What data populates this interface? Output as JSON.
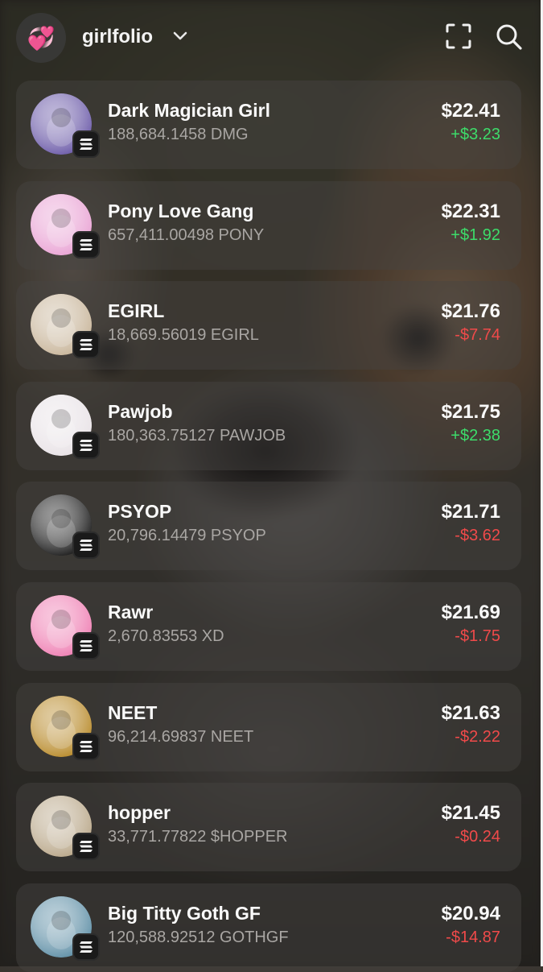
{
  "header": {
    "wallet_emoji": "💞",
    "wallet_name": "girlfolio",
    "icons": [
      "chevron-down-icon",
      "scan-icon",
      "search-icon"
    ]
  },
  "colors": {
    "positive": "#3ddc6a",
    "negative": "#f04a4a"
  },
  "tokens": [
    {
      "name": "Dark Magician Girl",
      "balance": "188,684.1458 DMG",
      "value": "$22.41",
      "change": "+$3.23",
      "trend": "up",
      "icon_color": "#6b5aa8"
    },
    {
      "name": "Pony Love Gang",
      "balance": "657,411.00498 PONY",
      "value": "$22.31",
      "change": "+$1.92",
      "trend": "up",
      "icon_color": "#e9a3d4"
    },
    {
      "name": "EGIRL",
      "balance": "18,669.56019 EGIRL",
      "value": "$21.76",
      "change": "-$7.74",
      "trend": "down",
      "icon_color": "#c8b59a"
    },
    {
      "name": "Pawjob",
      "balance": "180,363.75127 PAWJOB",
      "value": "$21.75",
      "change": "+$2.38",
      "trend": "up",
      "icon_color": "#e8e2e6"
    },
    {
      "name": "PSYOP",
      "balance": "20,796.14479 PSYOP",
      "value": "$21.71",
      "change": "-$3.62",
      "trend": "down",
      "icon_color": "#1b1b1b"
    },
    {
      "name": "Rawr",
      "balance": "2,670.83553 XD",
      "value": "$21.69",
      "change": "-$1.75",
      "trend": "down",
      "icon_color": "#ef7fb3"
    },
    {
      "name": "NEET",
      "balance": "96,214.69837 NEET",
      "value": "$21.63",
      "change": "-$2.22",
      "trend": "down",
      "icon_color": "#b88a2a"
    },
    {
      "name": "hopper",
      "balance": "33,771.77822 $HOPPER",
      "value": "$21.45",
      "change": "-$0.24",
      "trend": "down",
      "icon_color": "#b9a789"
    },
    {
      "name": "Big Titty Goth GF",
      "balance": "120,588.92512 GOTHGF",
      "value": "$20.94",
      "change": "-$14.87",
      "trend": "down",
      "icon_color": "#5f8fa6"
    }
  ]
}
